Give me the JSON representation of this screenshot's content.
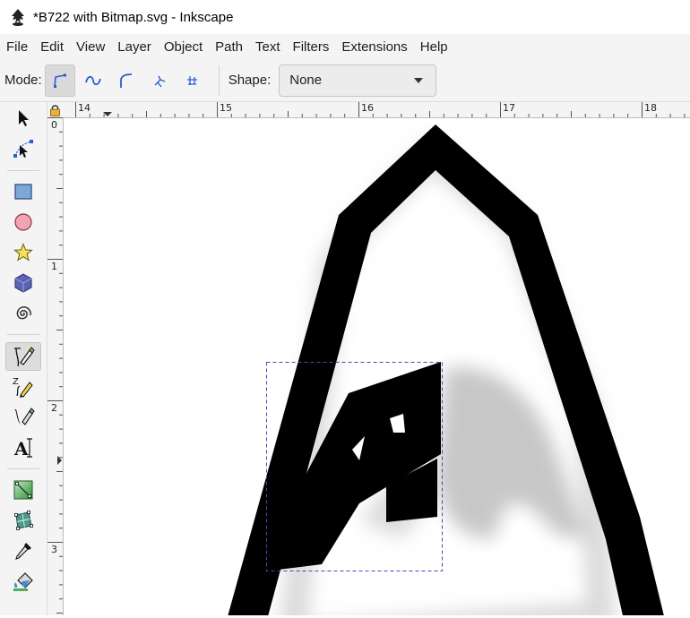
{
  "window": {
    "title": "*B722 with Bitmap.svg - Inkscape"
  },
  "menubar": {
    "items": [
      "File",
      "Edit",
      "View",
      "Layer",
      "Object",
      "Path",
      "Text",
      "Filters",
      "Extensions",
      "Help"
    ]
  },
  "toolbar": {
    "mode_label": "Mode:",
    "mode_buttons": [
      "regular-bezier-icon",
      "spiro-path-icon",
      "bspline-path-icon",
      "paraxial-line-icon",
      "paraxial-line-alt-icon"
    ],
    "active_mode_index": 0,
    "shape_label": "Shape:",
    "shape_value": "None"
  },
  "toolbox": {
    "tools": [
      "selector-tool-icon",
      "node-tool-icon",
      "rectangle-tool-icon",
      "ellipse-tool-icon",
      "star-tool-icon",
      "3d-box-tool-icon",
      "spiral-tool-icon",
      "bezier-pen-tool-icon",
      "pencil-tool-icon",
      "calligraphy-tool-icon",
      "text-tool-icon",
      "gradient-tool-icon",
      "mesh-tool-icon",
      "dropper-tool-icon",
      "paint-bucket-tool-icon"
    ],
    "active_tool": "bezier-pen-tool-icon"
  },
  "rulers": {
    "horizontal_labels": [
      "14",
      "15",
      "16",
      "17",
      "18"
    ],
    "vertical_labels": [
      "0",
      "1",
      "2",
      "3"
    ]
  },
  "colors": {
    "chrome_bg": "#f4f4f4",
    "canvas_bg": "#ffffff",
    "accent_blue": "#2a5bd7",
    "path_fill": "#000000",
    "selection_dash": "#4a4ab0"
  }
}
